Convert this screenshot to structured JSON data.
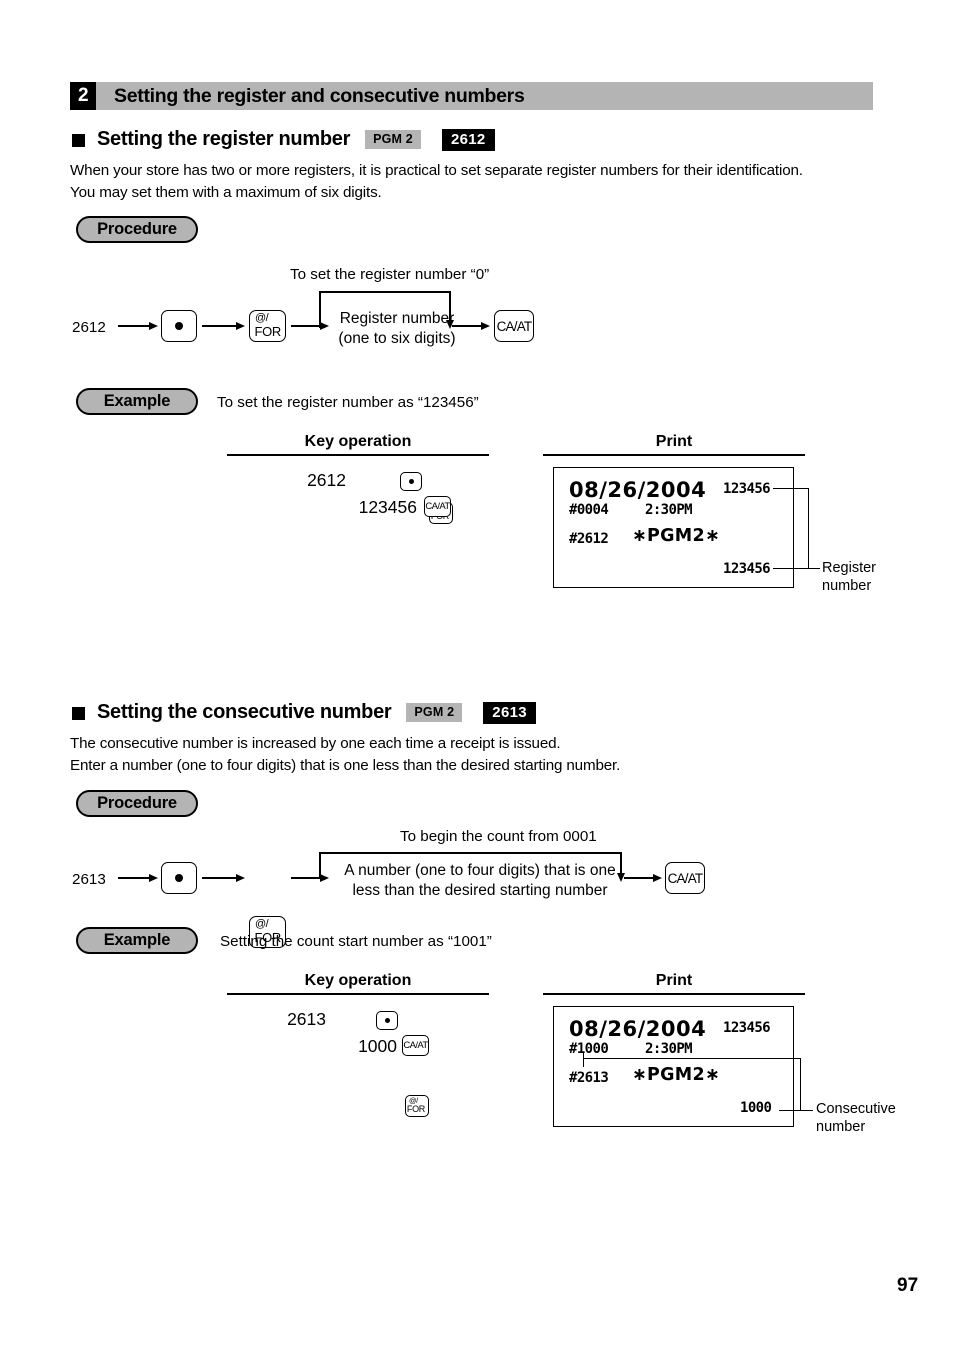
{
  "page": {
    "number": "97"
  },
  "section": {
    "number": "2",
    "title": "Setting the register and consecutive numbers"
  },
  "register_number": {
    "heading": "Setting the register number",
    "mode_badge": "PGM 2",
    "code_badge": "2612",
    "description": "When your store has two or more registers, it is practical to set separate register numbers for their identification.\nYou may set them with a maximum of six digits.",
    "procedure": {
      "label": "Procedure",
      "start_code": "2612",
      "note_above": "To set the register number “0”",
      "entry_label": "Register number\n(one to six digits)",
      "key_dot": "•",
      "key_at_top": "@/",
      "key_at_bottom": "FOR",
      "key_caat": "CA/AT"
    },
    "example": {
      "label": "Example",
      "text": "To set the register number as “123456”",
      "key_operation_header": "Key operation",
      "print_header": "Print",
      "keys": {
        "row1_number": "2612",
        "row1_dot": "•",
        "row1_at_top": "@/",
        "row1_at_bottom": "FOR",
        "row2_number": "123456",
        "row2_caat": "CA/AT"
      },
      "receipt": {
        "date": "08/26/2004",
        "top_right": "123456",
        "counter": "#0004",
        "time": "2:30PM",
        "prog_code": "#2612",
        "prog_label": "∗PGM2∗",
        "value": "123456"
      },
      "callout": "Register\nnumber"
    }
  },
  "consecutive_number": {
    "heading": "Setting the consecutive number",
    "mode_badge": "PGM 2",
    "code_badge": "2613",
    "description": "The consecutive number is increased by one each time a receipt is issued.\nEnter a number (one to four digits) that is one less than the desired starting number.",
    "procedure": {
      "label": "Procedure",
      "start_code": "2613",
      "note_above": "To begin the count from 0001",
      "entry_label": "A number (one to four digits) that is one\nless than the desired starting number",
      "key_dot": "•",
      "key_at_top": "@/",
      "key_at_bottom": "FOR",
      "key_caat": "CA/AT"
    },
    "example": {
      "label": "Example",
      "text": "Setting the count start number as “1001”",
      "key_operation_header": "Key operation",
      "print_header": "Print",
      "keys": {
        "row1_number": "2613",
        "row1_dot": "•",
        "row1_at_top": "@/",
        "row1_at_bottom": "FOR",
        "row2_number": "1000",
        "row2_caat": "CA/AT"
      },
      "receipt": {
        "date": "08/26/2004",
        "top_right": "123456",
        "counter": "#1000",
        "time": "2:30PM",
        "prog_code": "#2613",
        "prog_label": "∗PGM2∗",
        "value": "1000"
      },
      "callout": "Consecutive\nnumber"
    }
  },
  "colors": {
    "bar_gray": "#b4b4b4",
    "badge_black": "#000000",
    "text": "#000000",
    "background": "#ffffff"
  }
}
